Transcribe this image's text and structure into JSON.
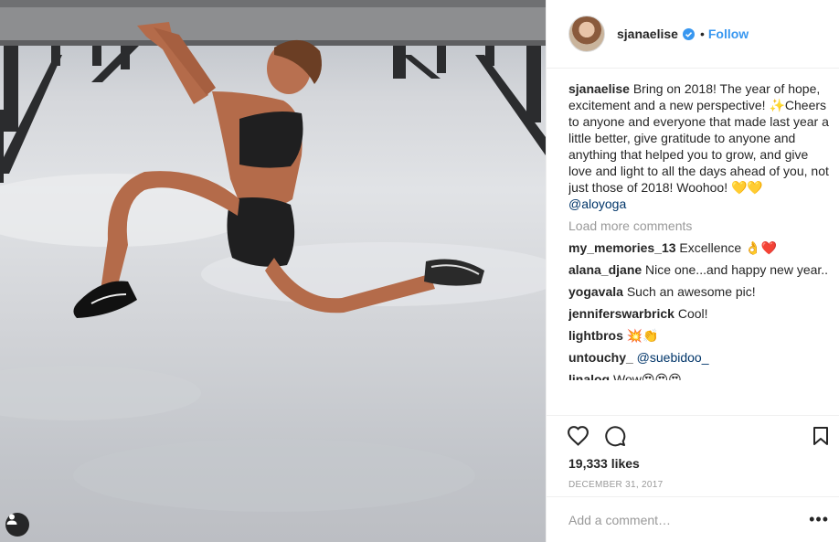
{
  "header": {
    "username": "sjanaelise",
    "follow_label": "Follow",
    "dot": "•"
  },
  "caption": {
    "username": "sjanaelise",
    "text": "Bring on 2018! The year of hope, excitement and a new perspective! ✨Cheers to anyone and everyone that made last year a little better, give gratitude to anyone and anything that helped you to grow, and give love and light to all the days ahead of you, not just those of 2018! Woohoo! 💛💛",
    "mention": "@aloyoga"
  },
  "load_more": "Load more comments",
  "comments": [
    {
      "user": "my_memories_13",
      "text": "Excellence 👌❤️"
    },
    {
      "user": "alana_djane",
      "text": "Nice one...and happy new year.."
    },
    {
      "user": "yogavala",
      "text": "Such an awesome pic!"
    },
    {
      "user": "jenniferswarbrick",
      "text": "Cool!"
    },
    {
      "user": "lightbros",
      "text": "💥👏"
    },
    {
      "user": "untouchy_",
      "text": "@suebidoo_"
    },
    {
      "user": "linalog",
      "text": "Wow😍😍😍"
    }
  ],
  "likes": "19,333 likes",
  "date": "DECEMBER 31, 2017",
  "add_comment_placeholder": "Add a comment…",
  "more_label": "•••",
  "colors": {
    "accent": "#3897f0",
    "mention": "#003569",
    "muted": "#999999"
  },
  "icons": [
    "verified-badge-icon",
    "heart-icon",
    "comment-icon",
    "bookmark-icon",
    "user-tag-icon",
    "more-options-icon"
  ]
}
